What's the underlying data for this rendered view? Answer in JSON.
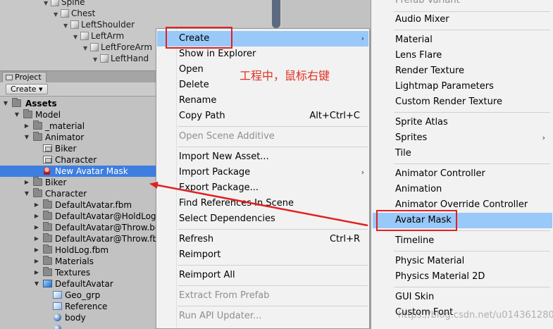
{
  "hierarchy": {
    "items": [
      {
        "label": "Spine"
      },
      {
        "label": "Chest"
      },
      {
        "label": "LeftShoulder"
      },
      {
        "label": "LeftArm"
      },
      {
        "label": "LeftForeArm"
      },
      {
        "label": "LeftHand"
      }
    ]
  },
  "project": {
    "tab_label": "Project",
    "create_label": "Create ▾",
    "tree": [
      {
        "label": "Assets",
        "kind": "folder"
      },
      {
        "label": "Model",
        "kind": "folder"
      },
      {
        "label": "_material",
        "kind": "folder"
      },
      {
        "label": "Animator",
        "kind": "folder"
      },
      {
        "label": "Biker",
        "kind": "controller"
      },
      {
        "label": "Character",
        "kind": "controller"
      },
      {
        "label": "New Avatar Mask",
        "kind": "avatar-mask",
        "selected": true
      },
      {
        "label": "Biker",
        "kind": "folder"
      },
      {
        "label": "Character",
        "kind": "folder"
      },
      {
        "label": "DefaultAvatar.fbm",
        "kind": "folder"
      },
      {
        "label": "DefaultAvatar@HoldLog.f",
        "kind": "folder"
      },
      {
        "label": "DefaultAvatar@Throw.bc",
        "kind": "folder"
      },
      {
        "label": "DefaultAvatar@Throw.fbx",
        "kind": "folder"
      },
      {
        "label": "HoldLog.fbm",
        "kind": "folder"
      },
      {
        "label": "Materials",
        "kind": "folder"
      },
      {
        "label": "Textures",
        "kind": "folder"
      },
      {
        "label": "DefaultAvatar",
        "kind": "prefab"
      },
      {
        "label": "Geo_grp",
        "kind": "mesh"
      },
      {
        "label": "Reference",
        "kind": "mesh"
      },
      {
        "label": "body",
        "kind": "sphere"
      }
    ]
  },
  "context_menu": {
    "items": [
      {
        "label": "Create",
        "submenu": true,
        "highlighted": true
      },
      {
        "label": "Show in Explorer"
      },
      {
        "label": "Open"
      },
      {
        "label": "Delete"
      },
      {
        "label": "Rename"
      },
      {
        "label": "Copy Path",
        "shortcut": "Alt+Ctrl+C"
      },
      {
        "label": "Open Scene Additive",
        "disabled": true
      },
      {
        "label": "Import New Asset..."
      },
      {
        "label": "Import Package",
        "submenu": true
      },
      {
        "label": "Export Package..."
      },
      {
        "label": "Find References In Scene"
      },
      {
        "label": "Select Dependencies"
      },
      {
        "label": "Refresh",
        "shortcut": "Ctrl+R"
      },
      {
        "label": "Reimport"
      },
      {
        "label": "Reimport All"
      },
      {
        "label": "Extract From Prefab",
        "disabled": true
      },
      {
        "label": "Run API Updater...",
        "disabled": true
      }
    ]
  },
  "create_submenu": {
    "items": [
      {
        "label": "Prefab Variant",
        "disabled": true
      },
      {
        "label": "Audio Mixer"
      },
      {
        "label": "Material"
      },
      {
        "label": "Lens Flare"
      },
      {
        "label": "Render Texture"
      },
      {
        "label": "Lightmap Parameters"
      },
      {
        "label": "Custom Render Texture"
      },
      {
        "label": "Sprite Atlas"
      },
      {
        "label": "Sprites",
        "submenu": true
      },
      {
        "label": "Tile"
      },
      {
        "label": "Animator Controller"
      },
      {
        "label": "Animation"
      },
      {
        "label": "Animator Override Controller"
      },
      {
        "label": "Avatar Mask",
        "highlighted": true
      },
      {
        "label": "Timeline"
      },
      {
        "label": "Physic Material"
      },
      {
        "label": "Physics Material 2D"
      },
      {
        "label": "GUI Skin"
      },
      {
        "label": "Custom Font"
      }
    ]
  },
  "annotation": {
    "note": "工程中，鼠标右键",
    "color": "#e02020"
  },
  "watermark": "https://blog.csdn.net/u014361280",
  "colors": {
    "selection": "#3d7ee0",
    "menu_highlight": "#99c9f8",
    "menu_background": "#f2f2f2",
    "panel_background": "#c2c2c2"
  }
}
